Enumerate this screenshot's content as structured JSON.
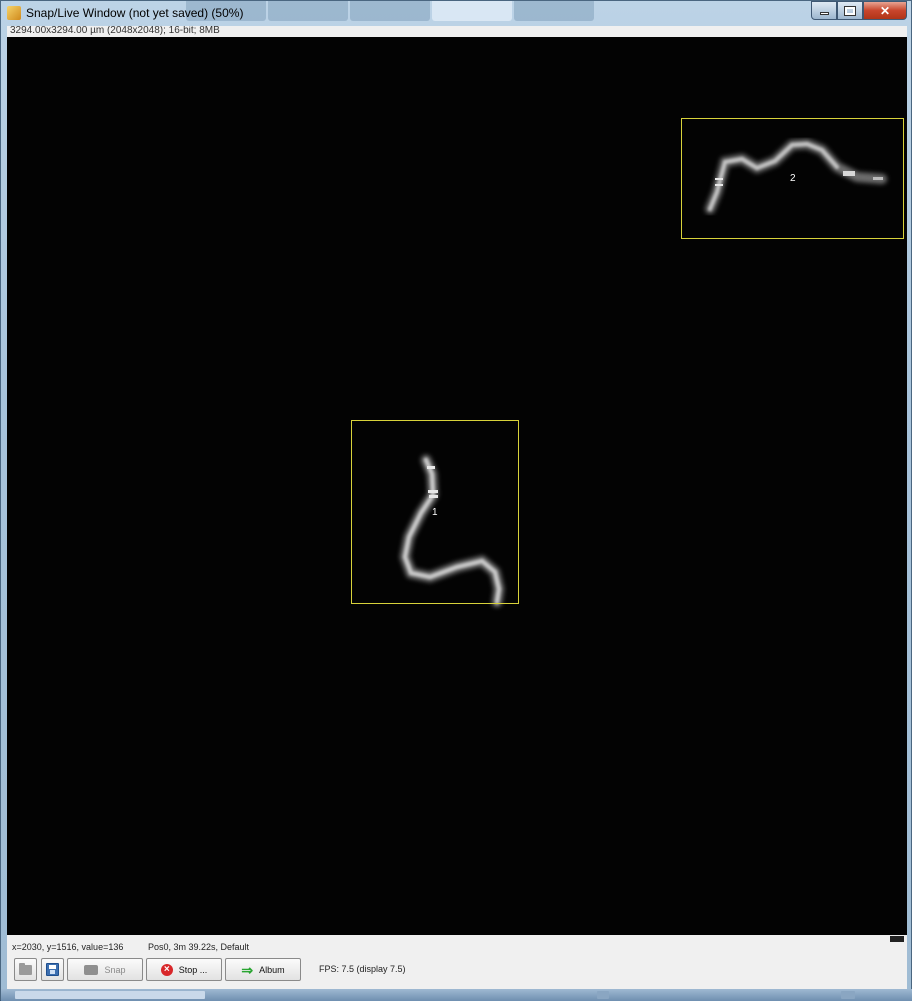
{
  "window": {
    "title": "Snap/Live Window (not yet saved) (50%)",
    "info": "3294.00x3294.00 µm (2048x2048); 16-bit; 8MB"
  },
  "rois": [
    {
      "label": "1",
      "color": "#d8d23a"
    },
    {
      "label": "2",
      "color": "#d8d23a"
    }
  ],
  "status": {
    "pixel_readout": "x=2030, y=1516, value=136",
    "position_time": "Pos0, 3m 39.22s, Default",
    "fps": "FPS: 7.5 (display 7.5)"
  },
  "buttons": {
    "snap": "Snap",
    "stop": "Stop ...",
    "album": "Album"
  },
  "icons": {
    "open": "folder-icon",
    "save": "save-icon",
    "snap": "camera-icon",
    "stop": "stop-icon",
    "album": "arrow-right-icon"
  }
}
